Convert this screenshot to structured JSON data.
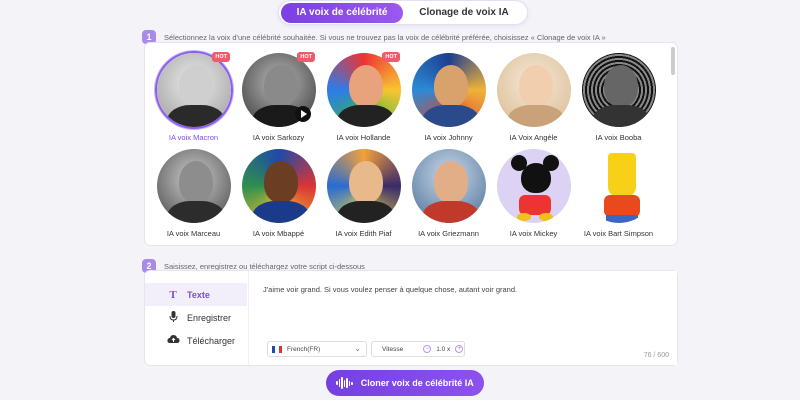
{
  "tabs": [
    {
      "label": "IA voix de célébrité",
      "active": true
    },
    {
      "label": "Clonage de voix IA",
      "active": false
    }
  ],
  "step1": {
    "num": "1",
    "text": "Sélectionnez la voix d'une célébrité souhaitée. Si vous ne trouvez pas la voix de célébrité préférée, choisissez « Clonage de voix IA »"
  },
  "voices": [
    {
      "name": "IA voix Macron",
      "hot": "HOT",
      "selected": true
    },
    {
      "name": "IA voix Sarkozy",
      "hot": "HOT",
      "play": true
    },
    {
      "name": "IA voix Hollande",
      "hot": "HOT"
    },
    {
      "name": "IA voix Johnny"
    },
    {
      "name": "IA Voix Angèle"
    },
    {
      "name": "IA voix Booba"
    },
    {
      "name": "IA voix Marceau"
    },
    {
      "name": "IA voix Mbappé"
    },
    {
      "name": "IA voix Edith Piaf"
    },
    {
      "name": "IA voix Griezmann"
    },
    {
      "name": "IA voix Mickey"
    },
    {
      "name": "IA voix Bart Simpson"
    }
  ],
  "step2": {
    "num": "2",
    "text": "Saisissez, enregistrez ou téléchargez votre script ci-dessous"
  },
  "script_modes": [
    {
      "label": "Texte",
      "icon": "text-icon",
      "active": true
    },
    {
      "label": "Enregistrer",
      "icon": "microphone-icon"
    },
    {
      "label": "Télécharger",
      "icon": "cloud-upload-icon"
    }
  ],
  "script": {
    "text": "J'aime voir grand. Si vous voulez penser à quelque chose, autant voir grand.",
    "language": "French(FR)",
    "speed_label": "Vitesse",
    "speed_value": "1.0 x",
    "counter": "76 / 600"
  },
  "cta_label": "Cloner voix de célébrité IA",
  "colors": {
    "accent": "#7b4ce8",
    "hot": "#f05a6a"
  }
}
